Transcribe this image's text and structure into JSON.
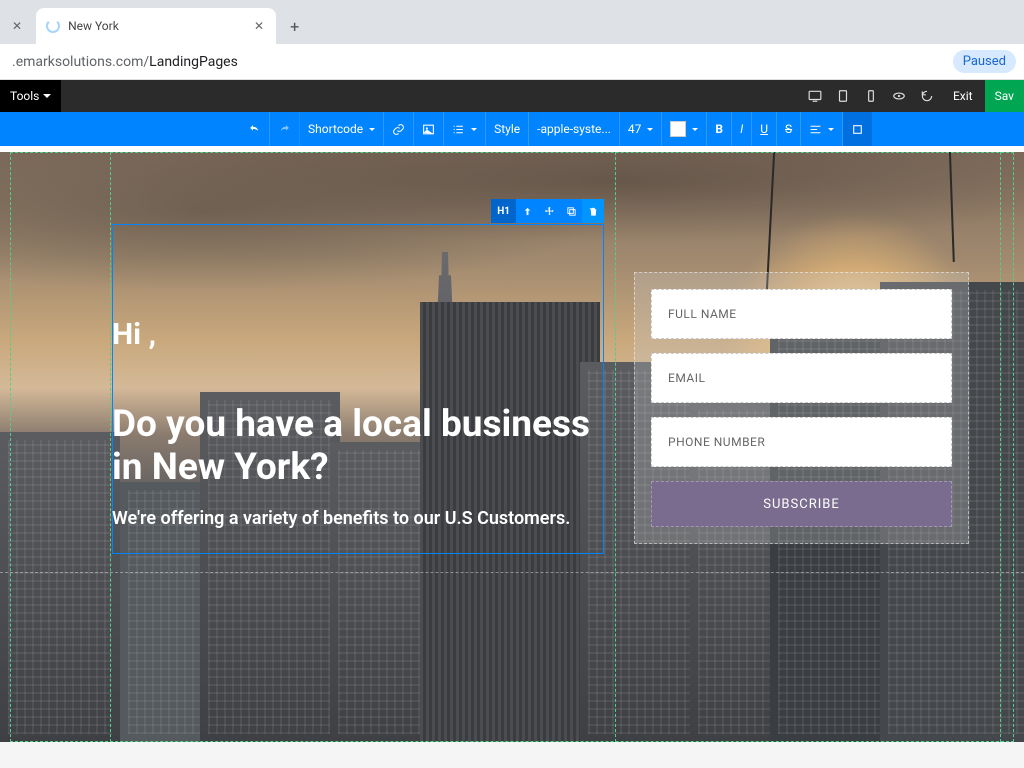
{
  "browser": {
    "tab_title": "New York",
    "url_host": ".emarksolutions.com/",
    "url_path": "LandingPages",
    "paused": "Paused"
  },
  "menubar": {
    "tools": "Tools",
    "exit": "Exit",
    "save": "Sav"
  },
  "toolbar": {
    "shortcode": "Shortcode",
    "style": "Style",
    "font": "-apple-syste...",
    "size": "47",
    "color": "#ffffff"
  },
  "selection": {
    "tag": "H1"
  },
  "hero": {
    "greet": "Hi ,",
    "headline": "Do you have a local business in New York?",
    "sub": "We're offering a variety of benefits to our U.S Customers."
  },
  "form": {
    "fullname": "FULL NAME",
    "email": "EMAIL",
    "phone": "PHONE NUMBER",
    "submit": "SUBSCRIBE"
  }
}
